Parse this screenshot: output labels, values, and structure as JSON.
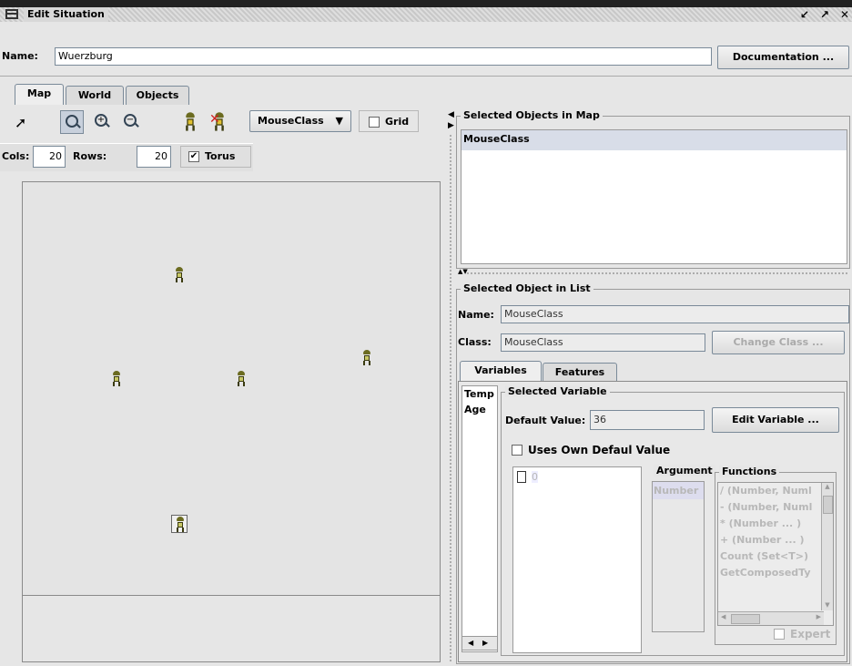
{
  "window": {
    "title": "Edit Situation"
  },
  "header": {
    "name_label": "Name:",
    "name_value": "Wuerzburg",
    "doc_button": "Documentation ..."
  },
  "tabs": [
    "Map",
    "World",
    "Objects"
  ],
  "toolbar": {
    "class_select": "MouseClass",
    "grid_label": "Grid"
  },
  "dims": {
    "cols_label": "Cols:",
    "cols_value": "20",
    "rows_label": "Rows:",
    "rows_value": "20",
    "torus_label": "Torus"
  },
  "map": {
    "cols": 20,
    "rows": 20,
    "mice": [
      {
        "col": 7,
        "row": 4
      },
      {
        "col": 16,
        "row": 8
      },
      {
        "col": 4,
        "row": 9
      },
      {
        "col": 10,
        "row": 9
      },
      {
        "col": 7,
        "row": 16,
        "selected": true
      }
    ]
  },
  "selected_map": {
    "title": "Selected Objects in Map",
    "items": [
      "MouseClass"
    ]
  },
  "selected_list": {
    "title": "Selected Object in List",
    "name_label": "Name:",
    "name_value": "MouseClass",
    "class_label": "Class:",
    "class_value": "MouseClass",
    "change_class_button": "Change Class ..."
  },
  "subtabs": [
    "Variables",
    "Features"
  ],
  "variables": {
    "list_header": "Temp",
    "items": [
      "Age"
    ]
  },
  "selected_variable": {
    "title": "Selected Variable",
    "default_label": "Default Value:",
    "default_value": "36",
    "edit_button": "Edit Variable ...",
    "uses_own_label": "Uses Own Defaul Value",
    "tree_value": "0",
    "argument_title": "Argument",
    "argument_items": [
      "Number"
    ],
    "functions_title": "Functions",
    "function_items": [
      "/ (Number, Numl",
      "- (Number, Numl",
      "* (Number ... )",
      "+ (Number ... )",
      "Count (Set<T>)",
      "GetComposedTy"
    ],
    "expert_label": "Expert"
  }
}
